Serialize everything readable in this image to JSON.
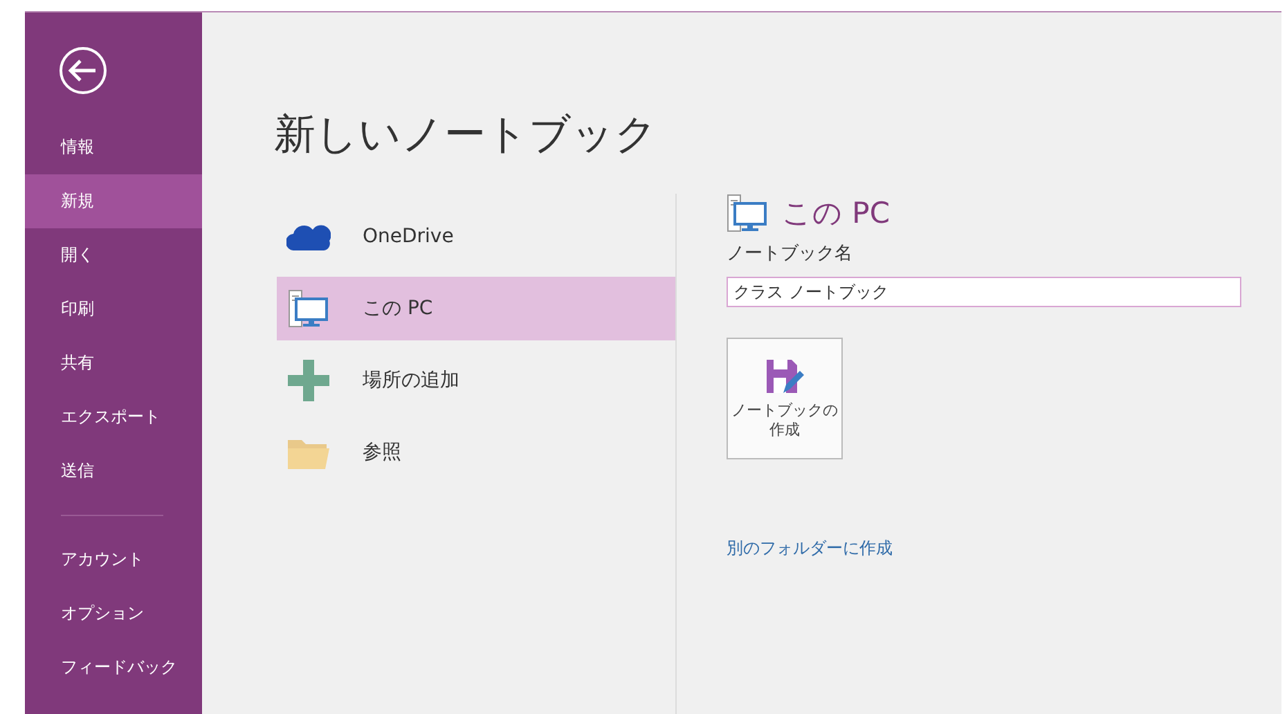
{
  "sidebar": {
    "items": [
      {
        "label": "情報",
        "selected": false
      },
      {
        "label": "新規",
        "selected": true
      },
      {
        "label": "開く",
        "selected": false
      },
      {
        "label": "印刷",
        "selected": false
      },
      {
        "label": "共有",
        "selected": false
      },
      {
        "label": "エクスポート",
        "selected": false
      },
      {
        "label": "送信",
        "selected": false
      },
      {
        "kind": "divider"
      },
      {
        "label": "アカウント",
        "selected": false
      },
      {
        "label": "オプション",
        "selected": false
      },
      {
        "label": "フィードバック",
        "selected": false
      }
    ]
  },
  "title": "新しいノートブック",
  "locations": [
    {
      "kind": "cloud",
      "label": "OneDrive",
      "selected": false
    },
    {
      "kind": "pc",
      "label": "この PC",
      "selected": true
    },
    {
      "kind": "add",
      "label": "場所の追加",
      "selected": false
    },
    {
      "kind": "folder",
      "label": "参照",
      "selected": false
    }
  ],
  "panel": {
    "heading": "この PC",
    "field_label": "ノートブック名",
    "field_value": "クラス ノートブック",
    "create_button": [
      "ノートブックの",
      "作成"
    ],
    "link": "別のフォルダーに作成"
  }
}
